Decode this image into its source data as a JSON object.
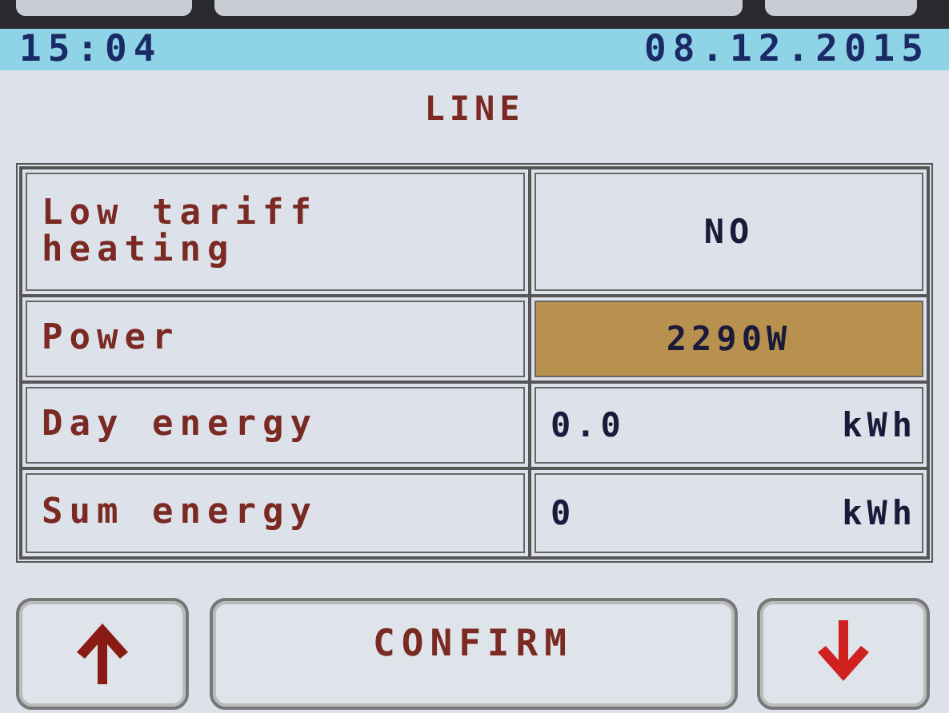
{
  "status_bar": {
    "time": "15:04",
    "date": "08.12.2015"
  },
  "title": "LINE",
  "rows": [
    {
      "label": "Low tariff heating",
      "value": "NO",
      "highlighted": false,
      "kind": "centered"
    },
    {
      "label": "Power",
      "value": "2290W",
      "highlighted": true,
      "kind": "centered"
    },
    {
      "label": "Day energy",
      "value": "0.0",
      "unit": "kWh",
      "highlighted": false,
      "kind": "unit"
    },
    {
      "label": "Sum energy",
      "value": "0",
      "unit": "kWh",
      "highlighted": false,
      "kind": "unit"
    }
  ],
  "buttons": [
    {
      "kind": "up"
    },
    {
      "kind": "text",
      "label": "CONFIRM"
    },
    {
      "kind": "down"
    }
  ]
}
